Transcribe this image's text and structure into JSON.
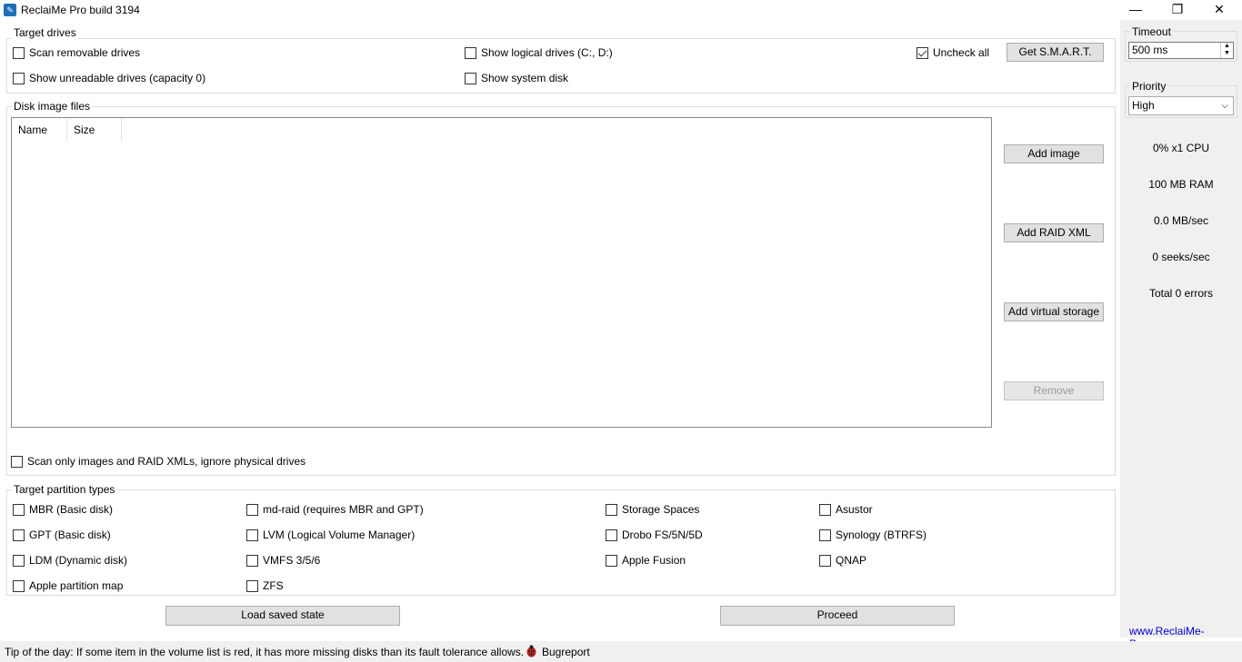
{
  "window": {
    "title": "ReclaiMe Pro build 3194",
    "app_icon": "wrench-icon",
    "minimize": "—",
    "restore": "❐",
    "close": "✕"
  },
  "target_drives": {
    "legend": "Target drives",
    "scan_removable": "Scan removable drives",
    "show_unreadable": "Show unreadable drives (capacity 0)",
    "show_logical": "Show logical drives (C:, D:)",
    "show_system": "Show system disk",
    "uncheck_all": "Uncheck all",
    "get_smart": "Get S.M.A.R.T."
  },
  "disk_image_files": {
    "legend": "Disk image files",
    "columns": [
      "Name",
      "Size"
    ],
    "rows": [],
    "add_image": "Add image",
    "add_raid_xml": "Add RAID XML",
    "add_virtual_storage": "Add virtual storage",
    "remove": "Remove",
    "scan_only_images": "Scan only images and RAID XMLs, ignore physical drives"
  },
  "partition_types": {
    "legend": "Target partition types",
    "col1": [
      "MBR (Basic disk)",
      "GPT (Basic disk)",
      "LDM (Dynamic disk)",
      "Apple partition map"
    ],
    "col2": [
      "md-raid (requires MBR and GPT)",
      "LVM (Logical Volume Manager)",
      "VMFS 3/5/6",
      "ZFS"
    ],
    "col3": [
      "Storage Spaces",
      "Drobo FS/5N/5D",
      "Apple Fusion"
    ],
    "col4": [
      "Asustor",
      "Synology (BTRFS)",
      "QNAP"
    ]
  },
  "actions": {
    "load_saved_state": "Load saved state",
    "proceed": "Proceed"
  },
  "side": {
    "timeout_legend": "Timeout",
    "timeout_value": "500 ms",
    "priority_legend": "Priority",
    "priority_value": "High",
    "cpu": "0% x1 CPU",
    "ram": "100 MB RAM",
    "throughput": "0.0 MB/sec",
    "seeks": "0 seeks/sec",
    "errors": "Total 0 errors",
    "website": "www.ReclaiMe-Pro.com"
  },
  "status": {
    "tip": "Tip of the day: If some item in the volume list is red, it has more missing disks than its fault tolerance allows.",
    "bug_icon": "ladybug-icon",
    "bugreport": "Bugreport"
  },
  "colors": {
    "panel_bg": "#f0f0f0",
    "button_bg": "#e1e1e1",
    "link": "#0000cc",
    "bug_red": "#c0221f"
  }
}
